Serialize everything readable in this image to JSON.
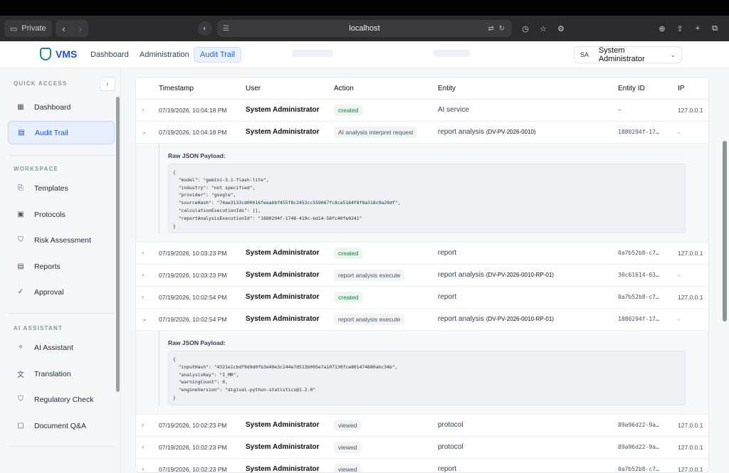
{
  "browser": {
    "private_label": "Private",
    "url": "localhost"
  },
  "header": {
    "app_name": "VMS",
    "nav": [
      {
        "label": "Dashboard"
      },
      {
        "label": "Administration"
      },
      {
        "label": "Audit Trail",
        "active": true
      }
    ],
    "user": {
      "initials": "SA",
      "name": "System Administrator"
    }
  },
  "sidebar": {
    "sections": [
      {
        "label": "QUICK ACCESS",
        "items": [
          {
            "label": "Dashboard",
            "icon": "grid-icon"
          },
          {
            "label": "Audit Trail",
            "icon": "audit-icon",
            "active": true
          }
        ]
      },
      {
        "label": "WORKSPACE",
        "items": [
          {
            "label": "Templates",
            "icon": "templates-icon"
          },
          {
            "label": "Protocols",
            "icon": "protocols-icon"
          },
          {
            "label": "Risk Assessment",
            "icon": "shield-icon"
          },
          {
            "label": "Reports",
            "icon": "reports-icon"
          },
          {
            "label": "Approval",
            "icon": "approval-icon"
          }
        ]
      },
      {
        "label": "AI ASSISTANT",
        "items": [
          {
            "label": "AI Assistant",
            "icon": "sparkle-icon"
          },
          {
            "label": "Translation",
            "icon": "translation-icon"
          },
          {
            "label": "Regulatory Check",
            "icon": "shield-check-icon"
          },
          {
            "label": "Document Q&A",
            "icon": "chat-icon"
          }
        ]
      }
    ]
  },
  "table": {
    "columns": [
      "Timestamp",
      "User",
      "Action",
      "Entity",
      "Entity ID",
      "IP"
    ],
    "payload_label": "Raw JSON Payload:",
    "rows": [
      {
        "ts": "07/19/2026, 10:04:18 PM",
        "user": "System Administrator",
        "action": "created",
        "action_color": "green",
        "entity": "AI service",
        "entity_code": "",
        "eid": "–",
        "ip": "127.0.0.1",
        "expanded": false
      },
      {
        "ts": "07/19/2026, 10:04:18 PM",
        "user": "System Administrator",
        "action": "AI analysis interpret request",
        "action_color": "gray",
        "entity": "report analysis",
        "entity_code": "(DV-PV-2026-0010)",
        "eid": "1880294f-17…",
        "ip": "-",
        "expanded": true,
        "payload": "{\n  \"model\": \"gemini-3.1-flash-lite\",\n  \"industry\": \"not specified\",\n  \"provider\": \"google\",\n  \"sourceHash\": \"74ae3133cd00016feeabbf455f8c2453cc559067fc8ce5164f8f8a318c9a20df\",\n  \"calculationExecutionIds\": [],\n  \"reportAnalysisExecutionId\": \"1880294f-1748-419c-bd14-58fc40fe0241\"\n}"
      },
      {
        "ts": "07/19/2026, 10:03:23 PM",
        "user": "System Administrator",
        "action": "created",
        "action_color": "green",
        "entity": "report",
        "entity_code": "",
        "eid": "0a7b52b8-c7…",
        "ip": "127.0.0.1",
        "expanded": false
      },
      {
        "ts": "07/19/2026, 10:03:23 PM",
        "user": "System Administrator",
        "action": "report analysis execute",
        "action_color": "gray",
        "entity": "report analysis",
        "entity_code": "(DV-PV-2026-0010-RP-01)",
        "eid": "30c61614-63…",
        "ip": "-",
        "expanded": false
      },
      {
        "ts": "07/19/2026, 10:02:54 PM",
        "user": "System Administrator",
        "action": "created",
        "action_color": "green",
        "entity": "report",
        "entity_code": "",
        "eid": "0a7b52b8-c7…",
        "ip": "127.0.0.1",
        "expanded": false
      },
      {
        "ts": "07/19/2026, 10:02:54 PM",
        "user": "System Administrator",
        "action": "report analysis execute",
        "action_color": "gray",
        "entity": "report analysis",
        "entity_code": "(DV-PV-2026-0010-RP-01)",
        "eid": "1880294f-17…",
        "ip": "-",
        "expanded": true,
        "payload": "{\n  \"inputHash\": \"4321e1cbdf9d9d0fb3e49e3c144e7d513b095e7a107130fce801474680abc34b\",\n  \"analysisKey\": \"I_MR\",\n  \"warningCount\": 0,\n  \"engineVersion\": \"digival-python-statistics@1.2.0\"\n}"
      },
      {
        "ts": "07/19/2026, 10:02:23 PM",
        "user": "System Administrator",
        "action": "viewed",
        "action_color": "gray",
        "entity": "protocol",
        "entity_code": "",
        "eid": "89a96d22-9a…",
        "ip": "127.0.0.1",
        "expanded": false
      },
      {
        "ts": "07/19/2026, 10:02:23 PM",
        "user": "System Administrator",
        "action": "viewed",
        "action_color": "gray",
        "entity": "protocol",
        "entity_code": "",
        "eid": "89a96d22-9a…",
        "ip": "127.0.0.1",
        "expanded": false
      },
      {
        "ts": "07/19/2026, 10:02:23 PM",
        "user": "System Administrator",
        "action": "viewed",
        "action_color": "gray",
        "entity": "report",
        "entity_code": "",
        "eid": "0a7b52b8-c7…",
        "ip": "127.0.0.1",
        "expanded": false
      }
    ]
  }
}
